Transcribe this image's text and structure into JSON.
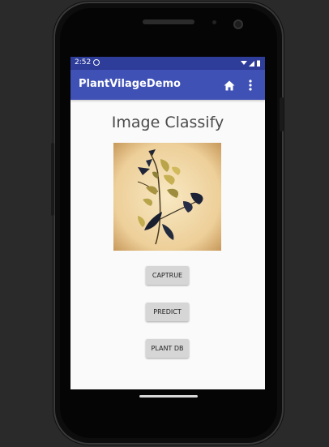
{
  "status_bar": {
    "time": "2:52"
  },
  "app_bar": {
    "title": "PlantVilageDemo",
    "home_icon": "home-icon",
    "more_icon": "more-vert-icon",
    "color": "#3f51b5"
  },
  "main": {
    "heading": "Image Classify",
    "buttons": [
      {
        "label": "CAPTRUE"
      },
      {
        "label": "PREDICT"
      },
      {
        "label": "PLANT DB"
      }
    ]
  },
  "colors": {
    "status_bar": "#2f3d9a",
    "app_bar": "#3f51b5",
    "screen_bg": "#fafafa",
    "button_bg": "#d6d6d6"
  }
}
